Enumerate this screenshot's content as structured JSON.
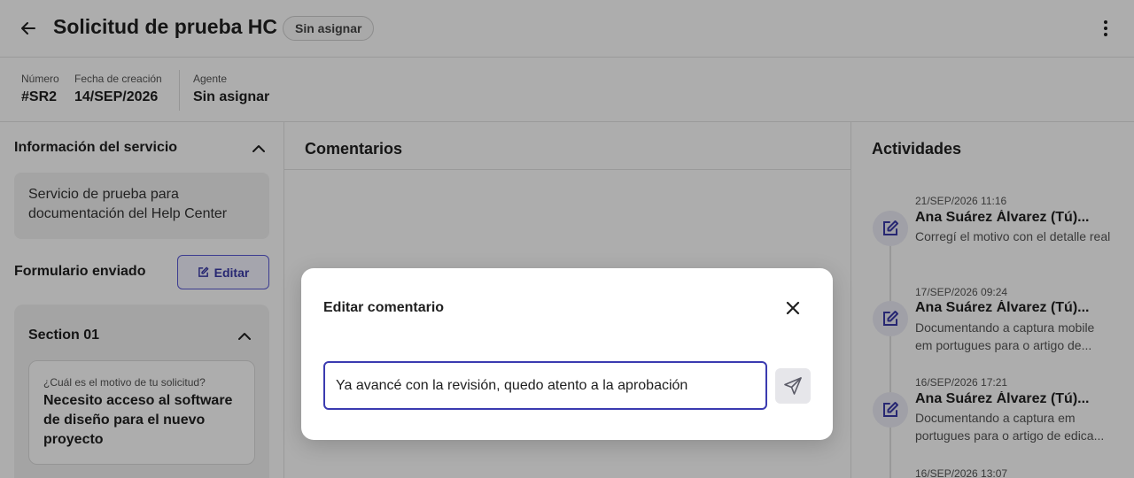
{
  "header": {
    "title": "Solicitud de prueba HC",
    "status": "Sin asignar"
  },
  "meta": {
    "number_label": "Número",
    "number_value": "#SR2",
    "created_label": "Fecha de creación",
    "created_value": "14/SEP/2026",
    "agent_label": "Agente",
    "agent_value": "Sin asignar"
  },
  "service": {
    "heading": "Información del servicio",
    "description": "Servicio de prueba para documentación del Help Center"
  },
  "form": {
    "label": "Formulario enviado",
    "edit_label": "Editar",
    "section_title": "Section 01",
    "question": "¿Cuál es el motivo de tu solicitud?",
    "answer": "Necesito acceso al software de diseño para el nuevo proyecto"
  },
  "comments": {
    "heading": "Comentarios"
  },
  "activities": {
    "heading": "Actividades",
    "items": [
      {
        "date": "21/SEP/2026 11:16",
        "user": "Ana Suárez Álvarez (Tú)...",
        "text": "Corregí el motivo con el detalle real"
      },
      {
        "date": "17/SEP/2026 09:24",
        "user": "Ana Suárez Álvarez (Tú)...",
        "text": "Documentando a captura mobile em portugues para o artigo de..."
      },
      {
        "date": "16/SEP/2026 17:21",
        "user": "Ana Suárez Álvarez (Tú)...",
        "text": "Documentando a captura em portugues para o artigo de edica..."
      },
      {
        "date": "16/SEP/2026 13:07",
        "user": "",
        "text": ""
      }
    ]
  },
  "modal": {
    "title": "Editar comentario",
    "input_value": "Ya avancé con la revisión, quedo atento a la aprobación"
  },
  "colors": {
    "accent": "#3b3bb0",
    "overlay": "rgba(0,0,0,0.32)"
  }
}
